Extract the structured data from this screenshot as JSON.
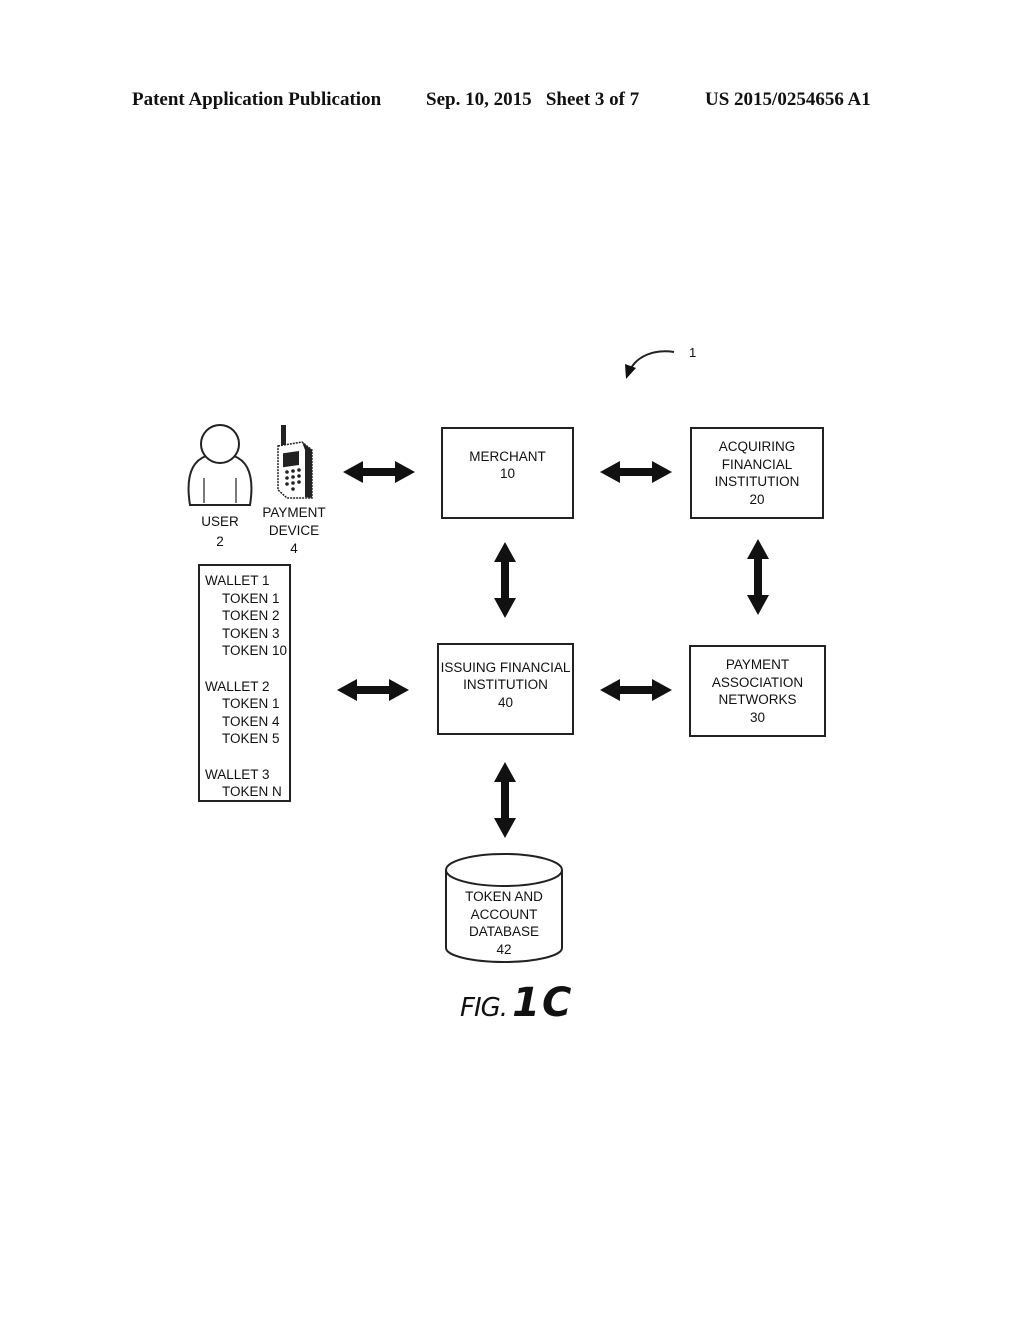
{
  "header": {
    "publication_type": "Patent Application Publication",
    "date_sheet": "Sep. 10, 2015   Sheet 3 of 7",
    "patent_number": "US 2015/0254656 A1"
  },
  "system_ref": "1",
  "user": {
    "label": "USER",
    "ref": "2",
    "icon": "user-icon"
  },
  "payment_device": {
    "label_line1": "PAYMENT",
    "label_line2": "DEVICE",
    "ref": "4",
    "icon": "mobile-phone-icon"
  },
  "wallets": [
    {
      "title": "WALLET 1",
      "tokens": [
        "TOKEN 1",
        "TOKEN 2",
        "TOKEN 3",
        "TOKEN 10"
      ]
    },
    {
      "title": "WALLET 2",
      "tokens": [
        "TOKEN 1",
        "TOKEN 4",
        "TOKEN 5"
      ]
    },
    {
      "title": "WALLET 3",
      "tokens": [
        "TOKEN N"
      ]
    }
  ],
  "merchant": {
    "lines": [
      "MERCHANT"
    ],
    "ref": "10"
  },
  "acquiring": {
    "lines": [
      "ACQUIRING",
      "FINANCIAL",
      "INSTITUTION"
    ],
    "ref": "20"
  },
  "issuing": {
    "lines": [
      "ISSUING FINANCIAL",
      "INSTITUTION"
    ],
    "ref": "40"
  },
  "payment_networks": {
    "lines": [
      "PAYMENT",
      "ASSOCIATION",
      "NETWORKS"
    ],
    "ref": "30"
  },
  "database": {
    "lines": [
      "TOKEN AND",
      "ACCOUNT",
      "DATABASE"
    ],
    "ref": "42"
  },
  "figure": {
    "prefix": "FIG.",
    "number": "1C"
  },
  "connections": [
    {
      "from": "user-device",
      "to": "merchant",
      "type": "bidirectional"
    },
    {
      "from": "merchant",
      "to": "acquiring-financial-institution",
      "type": "bidirectional"
    },
    {
      "from": "merchant",
      "to": "issuing-financial-institution",
      "type": "bidirectional"
    },
    {
      "from": "acquiring-financial-institution",
      "to": "payment-association-networks",
      "type": "bidirectional"
    },
    {
      "from": "wallets",
      "to": "issuing-financial-institution",
      "type": "bidirectional"
    },
    {
      "from": "issuing-financial-institution",
      "to": "payment-association-networks",
      "type": "bidirectional"
    },
    {
      "from": "issuing-financial-institution",
      "to": "token-account-database",
      "type": "bidirectional"
    }
  ]
}
